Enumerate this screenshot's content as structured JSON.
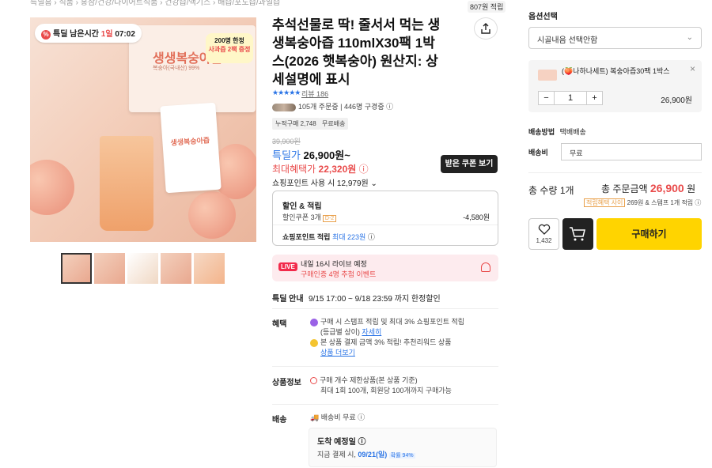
{
  "breadcrumb": "특딜홈 › 식품 › 홍삼/건강/다이어트식품 › 건강즙/액기스 › 배즙/포도즙/과일즙",
  "timer": {
    "label": "특딜 남은시간",
    "day": "1일",
    "time": "07:02"
  },
  "image": {
    "box_title": "생생복숭아즙",
    "box_sub": "복숭아(국내산) 99%",
    "promo_line1": "200명 한정",
    "promo_line2": "사과즙 2팩 증정",
    "pouch_text": "생생복숭아즙",
    "brand": "시골내음"
  },
  "product": {
    "title": "추석선물로 딱! 줄서서 먹는 생생복숭아즙 110mlX30팩 1박스(2026 햇복숭아) 원산지: 상세설명에 표시",
    "point_tag": "807원 적립",
    "review_label": "리뷰 186",
    "orders": "105개 주문중",
    "watching": "446명 구경중",
    "chip_sales": "누적구매 2,748",
    "chip_ship": "무료배송"
  },
  "price": {
    "old": "39,900원",
    "deal_label": "특딜가",
    "deal_price": "26,900원~",
    "max_label": "최대혜택가",
    "max_price": "22,320원",
    "coupon_button": "받은 쿠폰 보기",
    "shop_point": "쇼핑포인트 사용 시 12,979원"
  },
  "discount": {
    "title": "할인 & 적립",
    "coupon_label": "할인쿠폰 3개",
    "coupon_tag": "D-2",
    "coupon_amount": "-4,580원",
    "save_label": "쇼핑포인트 적립",
    "save_value": "최대 223원"
  },
  "live": {
    "tag": "LIVE",
    "line1": "내일 16시 라이브 예정",
    "line2": "구매인증 4명 추첨 이벤트"
  },
  "rows": {
    "deal_info_k": "특딜 안내",
    "deal_info_v": "9/15 17:00 ~ 9/18 23:59 까지 한정할인",
    "benefit_k": "혜택",
    "benefit_1": "구매 시 스탬프 적립 및 최대 3% 쇼핑포인트 적립",
    "benefit_2": "(등급별 상이)",
    "benefit_link": "자세히",
    "benefit_3": "본 상품 결제 금액 3% 적립! 추천리워드 상품",
    "benefit_link2": "상품 더보기",
    "info_k": "상품정보",
    "info_1": "구매 개수 제한상품(본 상품 기준)",
    "info_2": "최대 1회 100개, 회원당 100개까지 구매가능",
    "ship_k": "배송",
    "ship_v": "배송비 무료",
    "arrive_title": "도착 예정일",
    "arrive_sub": "지금 결제 시,",
    "arrive_date": "09/21(일)",
    "arrive_pct": "확률 94%"
  },
  "side": {
    "option_head": "옵션선택",
    "select_text": "시골내음  선택안함",
    "selected_name": "(🍑나하나세트) 복숭아즙30팩 1박스",
    "qty": "1",
    "selected_price": "26,900원",
    "ship_method_k": "배송방법",
    "ship_method_v": "택배배송",
    "ship_fee_k": "배송비",
    "ship_fee_v": "무료",
    "total_qty_label": "총 수량",
    "total_qty": "1개",
    "total_label": "총 주문금액",
    "total_price": "26,900",
    "won": "원",
    "reward_tag": "적립혜택 사이",
    "reward_text": "269원 & 스탬프 1개 적립",
    "likes": "1,432",
    "buy": "구매하기"
  }
}
